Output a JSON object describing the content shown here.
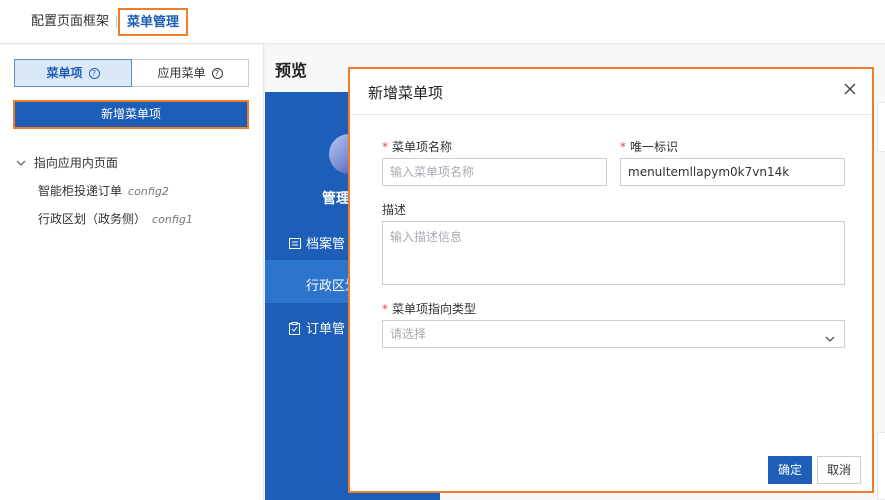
{
  "topbar": {
    "tab_frame": "配置页面框架",
    "tab_menu": "菜单管理"
  },
  "left_panel": {
    "seg_menu_item": "菜单项",
    "seg_app_menu": "应用菜单",
    "add_button": "新增菜单项",
    "tree": {
      "group_label": "指向应用内页面",
      "items": [
        {
          "label": "智能柜投递订单",
          "code": "config2"
        },
        {
          "label": "行政区划（政务侧）",
          "code": "config1"
        }
      ]
    }
  },
  "preview": {
    "title": "预览",
    "phone_title": "管理",
    "nav_items": [
      "档案管",
      "行政区划",
      "订单管"
    ]
  },
  "modal": {
    "title": "新增菜单项",
    "name_label": "菜单项名称",
    "name_placeholder": "输入菜单项名称",
    "id_label": "唯一标识",
    "id_value": "menuItemllapym0k7vn14k",
    "desc_label": "描述",
    "desc_placeholder": "输入描述信息",
    "type_label": "菜单项指向类型",
    "type_placeholder": "请选择",
    "ok_label": "确定",
    "cancel_label": "取消"
  },
  "colors": {
    "primary": "#1d5fb8",
    "highlight_border": "#ef7d28",
    "required": "#e5484d"
  }
}
